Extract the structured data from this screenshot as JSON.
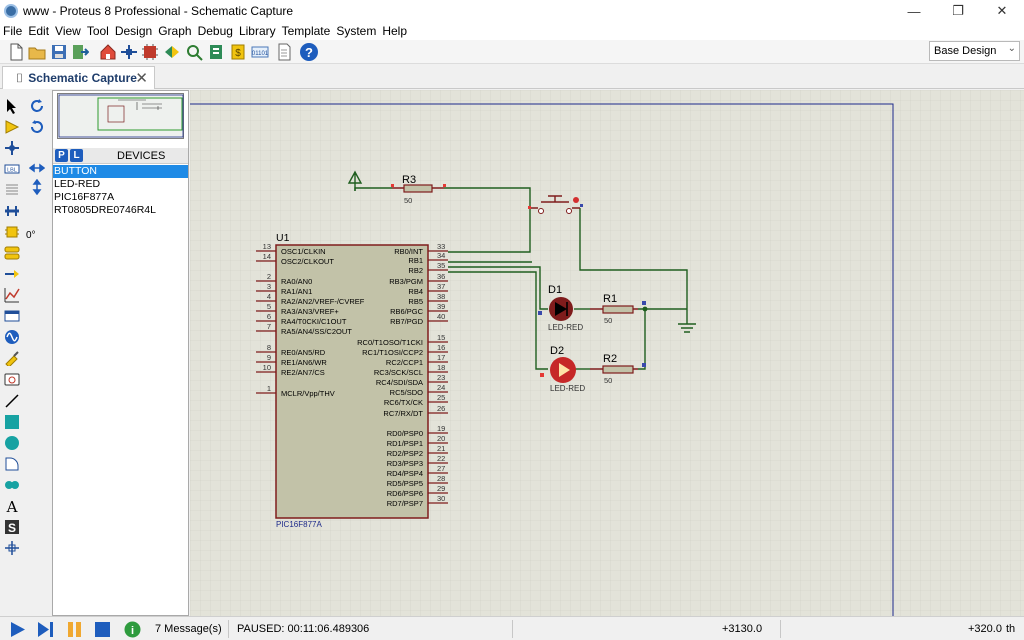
{
  "window": {
    "title": "www - Proteus 8 Professional - Schematic Capture"
  },
  "menu": [
    "File",
    "Edit",
    "View",
    "Tool",
    "Design",
    "Graph",
    "Debug",
    "Library",
    "Template",
    "System",
    "Help"
  ],
  "design_select": {
    "value": "Base Design"
  },
  "tab": {
    "label": "Schematic Capture"
  },
  "left_panel": {
    "rotation": "0°",
    "p_button": "P",
    "l_button": "L",
    "devices_title": "DEVICES",
    "devices": [
      "BUTTON",
      "LED-RED",
      "PIC16F877A",
      "RT0805DRE0746R4L"
    ],
    "selected_device": "BUTTON"
  },
  "schematic": {
    "u1": {
      "ref": "U1",
      "part": "PIC16F877A",
      "left_pins": [
        {
          "num": "13",
          "name": "OSC1/CLKIN"
        },
        {
          "num": "14",
          "name": "OSC2/CLKOUT"
        },
        {
          "num": "2",
          "name": "RA0/AN0"
        },
        {
          "num": "3",
          "name": "RA1/AN1"
        },
        {
          "num": "4",
          "name": "RA2/AN2/VREF-/CVREF"
        },
        {
          "num": "5",
          "name": "RA3/AN3/VREF+"
        },
        {
          "num": "6",
          "name": "RA4/T0CKI/C1OUT"
        },
        {
          "num": "7",
          "name": "RA5/AN4/SS/C2OUT"
        },
        {
          "num": "8",
          "name": "RE0/AN5/RD"
        },
        {
          "num": "9",
          "name": "RE1/AN6/WR"
        },
        {
          "num": "10",
          "name": "RE2/AN7/CS"
        },
        {
          "num": "1",
          "name": "MCLR/Vpp/THV"
        }
      ],
      "right_pins": [
        {
          "num": "33",
          "name": "RB0/INT"
        },
        {
          "num": "34",
          "name": "RB1"
        },
        {
          "num": "35",
          "name": "RB2"
        },
        {
          "num": "36",
          "name": "RB3/PGM"
        },
        {
          "num": "37",
          "name": "RB4"
        },
        {
          "num": "38",
          "name": "RB5"
        },
        {
          "num": "39",
          "name": "RB6/PGC"
        },
        {
          "num": "40",
          "name": "RB7/PGD"
        },
        {
          "num": "15",
          "name": "RC0/T1OSO/T1CKI"
        },
        {
          "num": "16",
          "name": "RC1/T1OSI/CCP2"
        },
        {
          "num": "17",
          "name": "RC2/CCP1"
        },
        {
          "num": "18",
          "name": "RC3/SCK/SCL"
        },
        {
          "num": "23",
          "name": "RC4/SDI/SDA"
        },
        {
          "num": "24",
          "name": "RC5/SDO"
        },
        {
          "num": "25",
          "name": "RC6/TX/CK"
        },
        {
          "num": "26",
          "name": "RC7/RX/DT"
        },
        {
          "num": "19",
          "name": "RD0/PSP0"
        },
        {
          "num": "20",
          "name": "RD1/PSP1"
        },
        {
          "num": "21",
          "name": "RD2/PSP2"
        },
        {
          "num": "22",
          "name": "RD3/PSP3"
        },
        {
          "num": "27",
          "name": "RD4/PSP4"
        },
        {
          "num": "28",
          "name": "RD5/PSP5"
        },
        {
          "num": "29",
          "name": "RD6/PSP6"
        },
        {
          "num": "30",
          "name": "RD7/PSP7"
        }
      ]
    },
    "r3": {
      "ref": "R3",
      "value": "50"
    },
    "r1": {
      "ref": "R1",
      "value": "50"
    },
    "r2": {
      "ref": "R2",
      "value": "50"
    },
    "d1": {
      "ref": "D1",
      "part": "LED-RED"
    },
    "d2": {
      "ref": "D2",
      "part": "LED-RED"
    }
  },
  "status": {
    "messages": "7 Message(s)",
    "sim_state": "PAUSED: 00:11:06.489306",
    "coord_x": "+3130.0",
    "coord_y": "+320.0",
    "unit": "th"
  }
}
